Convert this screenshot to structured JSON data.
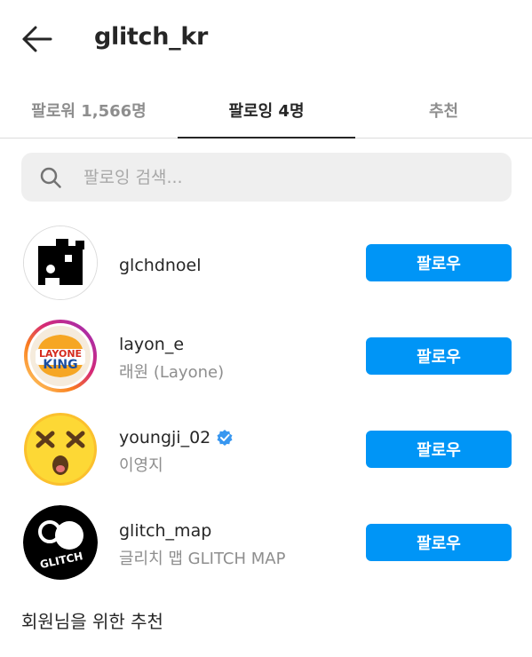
{
  "header": {
    "title": "glitch_kr",
    "back_icon": "arrow-left-icon"
  },
  "tabs": [
    {
      "label": "팔로워 1,566명",
      "active": false
    },
    {
      "label": "팔로잉 4명",
      "active": true
    },
    {
      "label": "추천",
      "active": false
    }
  ],
  "search": {
    "placeholder": "팔로잉 검색..."
  },
  "users": [
    {
      "username": "glchdnoel",
      "fullname": "",
      "verified": false,
      "button": "팔로우"
    },
    {
      "username": "layon_e",
      "fullname": "래원 (Layone)",
      "verified": false,
      "button": "팔로우",
      "avatar_logo_line1": "LAYONE",
      "avatar_logo_line2": "KING"
    },
    {
      "username": "youngji_02",
      "fullname": "이영지",
      "verified": true,
      "button": "팔로우"
    },
    {
      "username": "glitch_map",
      "fullname": "글리치 맵 GLITCH MAP",
      "verified": false,
      "button": "팔로우",
      "avatar_logo_text": "GLITCH"
    }
  ],
  "section": {
    "title": "회원님을 위한 추천"
  },
  "colors": {
    "follow_button": "#0095f6",
    "verified_badge": "#3897f0",
    "secondary_text": "#8e8e8e"
  }
}
